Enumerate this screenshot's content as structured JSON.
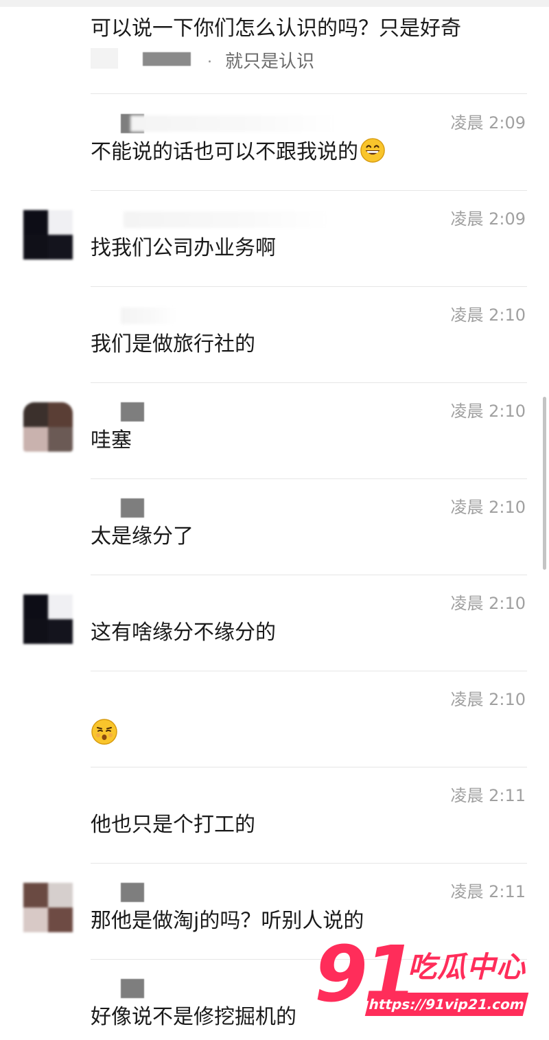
{
  "chat": {
    "partial_top_message": "可以说一下你们怎么认识的吗？只是好奇",
    "quoted_reply_text": "就只是认识",
    "messages": [
      {
        "time": "凌晨 2:09",
        "text": "不能说的话也可以不跟我说的",
        "avatar": "none",
        "emoji": "grinning-face"
      },
      {
        "time": "凌晨 2:09",
        "text": "找我们公司办业务啊",
        "avatar": "dark"
      },
      {
        "time": "凌晨 2:10",
        "text": "我们是做旅行社的",
        "avatar": "none"
      },
      {
        "time": "凌晨 2:10",
        "text": "哇塞",
        "avatar": "brown"
      },
      {
        "time": "凌晨 2:10",
        "text": "太是缘分了",
        "avatar": "none"
      },
      {
        "time": "凌晨 2:10",
        "text": "这有啥缘分不缘分的",
        "avatar": "dark"
      },
      {
        "time": "凌晨 2:10",
        "text": "",
        "avatar": "none",
        "sticker": "kissing-face"
      },
      {
        "time": "凌晨 2:11",
        "text": "他也只是个打工的",
        "avatar": "none"
      },
      {
        "time": "凌晨 2:11",
        "text": "那他是做淘j的吗？听别人说的",
        "avatar": "light"
      },
      {
        "time": "",
        "text": "好像说不是修挖掘机的",
        "avatar": "none"
      }
    ]
  },
  "watermark": {
    "number": "91",
    "title": "吃瓜中心",
    "url": "https://91vip21.com",
    "color": "#ff2d5a"
  },
  "colors": {
    "text": "#1a1a1a",
    "timestamp": "#a0a0a0",
    "divider": "#e6e6e6",
    "redaction": "#7e7e7e"
  }
}
